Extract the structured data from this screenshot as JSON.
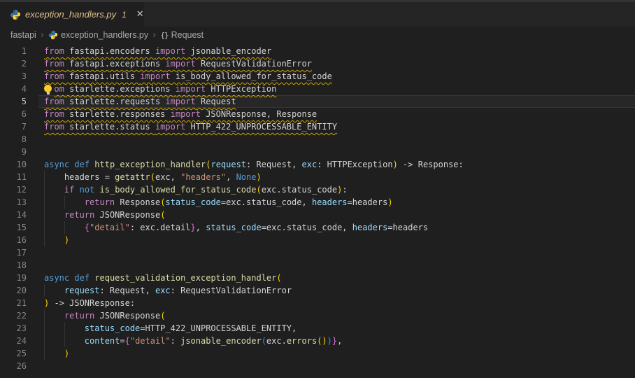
{
  "tab": {
    "filename": "exception_handlers.py",
    "badge": "1",
    "close_glyph": "✕"
  },
  "breadcrumb": {
    "items": [
      "fastapi",
      "exception_handlers.py",
      "Request"
    ],
    "namespace_glyph": "{}",
    "separator": "›"
  },
  "colors": {
    "bg": "#1f1f1f",
    "tabbar_bg": "#252526",
    "modified": "#e2c08d",
    "breadcrumb_fg": "#a9a9a9",
    "linenum": "#858585",
    "linenum_active": "#c6c6c6",
    "fg": "#d4d4d4",
    "keyword": "#c586c0",
    "keyword2": "#569cd6",
    "func": "#dcdcaa",
    "variable": "#9cdcfe",
    "string": "#ce9178",
    "bracket1": "#ffd700",
    "bracket2": "#da70d6",
    "bracket3": "#179fff",
    "squiggle": "#cca700"
  },
  "editor": {
    "lines": [
      {
        "n": 1,
        "squiggle": true,
        "tokens": [
          [
            "kw",
            "from"
          ],
          [
            "txt",
            " fastapi.encoders "
          ],
          [
            "kw",
            "import"
          ],
          [
            "txt",
            " jsonable_encoder"
          ]
        ]
      },
      {
        "n": 2,
        "squiggle": true,
        "tokens": [
          [
            "kw",
            "from"
          ],
          [
            "txt",
            " fastapi.exceptions "
          ],
          [
            "kw",
            "import"
          ],
          [
            "txt",
            " RequestValidationError"
          ]
        ]
      },
      {
        "n": 3,
        "squiggle": true,
        "tokens": [
          [
            "kw",
            "from"
          ],
          [
            "txt",
            " fastapi.utils "
          ],
          [
            "kw",
            "import"
          ],
          [
            "txt",
            " is_body_allowed_for_status_code"
          ]
        ]
      },
      {
        "n": 4,
        "squiggle": true,
        "bulb": true,
        "tokens": [
          [
            "kw",
            "om"
          ],
          [
            "txt",
            " starlette.exceptions "
          ],
          [
            "kw",
            "import"
          ],
          [
            "txt",
            " HTTPException"
          ]
        ]
      },
      {
        "n": 5,
        "active": true,
        "squiggle": true,
        "tokens": [
          [
            "kw",
            "from"
          ],
          [
            "txt",
            " starlette.requests "
          ],
          [
            "kw",
            "import"
          ],
          [
            "txt",
            " Request"
          ]
        ]
      },
      {
        "n": 6,
        "squiggle": true,
        "tokens": [
          [
            "kw",
            "from"
          ],
          [
            "txt",
            " starlette.responses "
          ],
          [
            "kw",
            "import"
          ],
          [
            "txt",
            " JSONResponse, Response"
          ]
        ]
      },
      {
        "n": 7,
        "squiggle": true,
        "tokens": [
          [
            "kw",
            "from"
          ],
          [
            "txt",
            " starlette.status "
          ],
          [
            "kw",
            "import"
          ],
          [
            "txt",
            " HTTP_422_UNPROCESSABLE_ENTITY"
          ]
        ]
      },
      {
        "n": 8,
        "tokens": []
      },
      {
        "n": 9,
        "tokens": []
      },
      {
        "n": 10,
        "tokens": [
          [
            "kw2",
            "async"
          ],
          [
            "txt",
            " "
          ],
          [
            "kw2",
            "def"
          ],
          [
            "txt",
            " "
          ],
          [
            "fn",
            "http_exception_handler"
          ],
          [
            "b1",
            "("
          ],
          [
            "var",
            "request"
          ],
          [
            "txt",
            ": Request, "
          ],
          [
            "var",
            "exc"
          ],
          [
            "txt",
            ": HTTPException"
          ],
          [
            "b1",
            ")"
          ],
          [
            "txt",
            " -> Response:"
          ]
        ]
      },
      {
        "n": 11,
        "guides": [
          0
        ],
        "tokens": [
          [
            "txt",
            "    headers = "
          ],
          [
            "fn",
            "getattr"
          ],
          [
            "b1",
            "("
          ],
          [
            "txt",
            "exc, "
          ],
          [
            "str",
            "\"headers\""
          ],
          [
            "txt",
            ", "
          ],
          [
            "kw2",
            "None"
          ],
          [
            "b1",
            ")"
          ]
        ]
      },
      {
        "n": 12,
        "guides": [
          0
        ],
        "tokens": [
          [
            "txt",
            "    "
          ],
          [
            "kw",
            "if"
          ],
          [
            "txt",
            " "
          ],
          [
            "kw2",
            "not"
          ],
          [
            "txt",
            " "
          ],
          [
            "fn",
            "is_body_allowed_for_status_code"
          ],
          [
            "b1",
            "("
          ],
          [
            "txt",
            "exc.status_code"
          ],
          [
            "b1",
            ")"
          ],
          [
            "txt",
            ":"
          ]
        ]
      },
      {
        "n": 13,
        "guides": [
          0,
          4
        ],
        "tokens": [
          [
            "txt",
            "        "
          ],
          [
            "kw",
            "return"
          ],
          [
            "txt",
            " Response"
          ],
          [
            "b1",
            "("
          ],
          [
            "var",
            "status_code"
          ],
          [
            "txt",
            "=exc.status_code, "
          ],
          [
            "var",
            "headers"
          ],
          [
            "txt",
            "=headers"
          ],
          [
            "b1",
            ")"
          ]
        ]
      },
      {
        "n": 14,
        "guides": [
          0
        ],
        "tokens": [
          [
            "txt",
            "    "
          ],
          [
            "kw",
            "return"
          ],
          [
            "txt",
            " JSONResponse"
          ],
          [
            "b1",
            "("
          ]
        ]
      },
      {
        "n": 15,
        "guides": [
          0,
          4
        ],
        "tokens": [
          [
            "txt",
            "        "
          ],
          [
            "b2",
            "{"
          ],
          [
            "str",
            "\"detail\""
          ],
          [
            "txt",
            ": exc.detail"
          ],
          [
            "b2",
            "}"
          ],
          [
            "txt",
            ", "
          ],
          [
            "var",
            "status_code"
          ],
          [
            "txt",
            "=exc.status_code, "
          ],
          [
            "var",
            "headers"
          ],
          [
            "txt",
            "=headers"
          ]
        ]
      },
      {
        "n": 16,
        "guides": [
          0
        ],
        "tokens": [
          [
            "txt",
            "    "
          ],
          [
            "b1",
            ")"
          ]
        ]
      },
      {
        "n": 17,
        "tokens": []
      },
      {
        "n": 18,
        "tokens": []
      },
      {
        "n": 19,
        "tokens": [
          [
            "kw2",
            "async"
          ],
          [
            "txt",
            " "
          ],
          [
            "kw2",
            "def"
          ],
          [
            "txt",
            " "
          ],
          [
            "fn",
            "request_validation_exception_handler"
          ],
          [
            "b1",
            "("
          ]
        ]
      },
      {
        "n": 20,
        "guides": [
          0
        ],
        "tokens": [
          [
            "txt",
            "    "
          ],
          [
            "var",
            "request"
          ],
          [
            "txt",
            ": Request, "
          ],
          [
            "var",
            "exc"
          ],
          [
            "txt",
            ": RequestValidationError"
          ]
        ]
      },
      {
        "n": 21,
        "tokens": [
          [
            "b1",
            ")"
          ],
          [
            "txt",
            " -> JSONResponse:"
          ]
        ]
      },
      {
        "n": 22,
        "guides": [
          0
        ],
        "tokens": [
          [
            "txt",
            "    "
          ],
          [
            "kw",
            "return"
          ],
          [
            "txt",
            " JSONResponse"
          ],
          [
            "b1",
            "("
          ]
        ]
      },
      {
        "n": 23,
        "guides": [
          0,
          4
        ],
        "tokens": [
          [
            "txt",
            "        "
          ],
          [
            "var",
            "status_code"
          ],
          [
            "txt",
            "=HTTP_422_UNPROCESSABLE_ENTITY,"
          ]
        ]
      },
      {
        "n": 24,
        "guides": [
          0,
          4
        ],
        "tokens": [
          [
            "txt",
            "        "
          ],
          [
            "var",
            "content"
          ],
          [
            "txt",
            "="
          ],
          [
            "b2",
            "{"
          ],
          [
            "str",
            "\"detail\""
          ],
          [
            "txt",
            ": "
          ],
          [
            "fn",
            "jsonable_encoder"
          ],
          [
            "b3",
            "("
          ],
          [
            "txt",
            "exc."
          ],
          [
            "fn",
            "errors"
          ],
          [
            "b1",
            "()"
          ],
          [
            "b3",
            ")"
          ],
          [
            "b2",
            "}"
          ],
          [
            "txt",
            ","
          ]
        ]
      },
      {
        "n": 25,
        "guides": [
          0
        ],
        "tokens": [
          [
            "txt",
            "    "
          ],
          [
            "b1",
            ")"
          ]
        ]
      },
      {
        "n": 26,
        "tokens": []
      }
    ]
  }
}
